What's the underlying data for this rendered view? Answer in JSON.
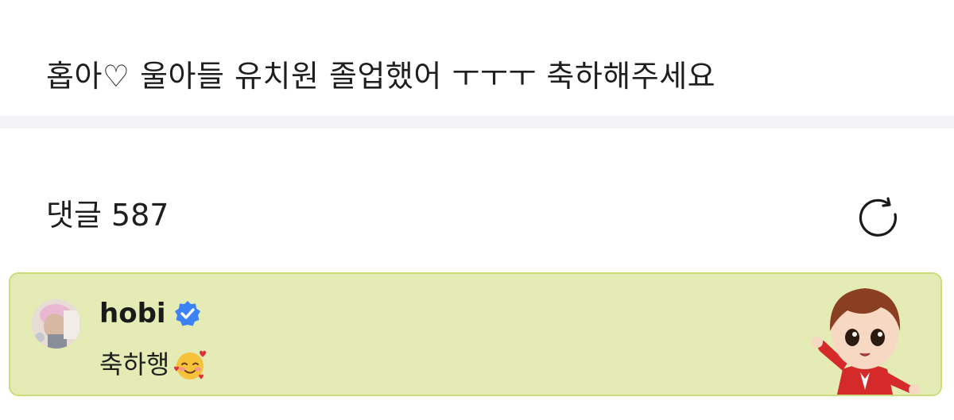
{
  "post": {
    "text": "홉아♡ 울아들 유치원 졸업했어 ㅜㅜㅜ 축하해주세요"
  },
  "comments": {
    "label": "댓글",
    "count": "587",
    "refresh_icon": "refresh-icon"
  },
  "comment": {
    "author": "hobi",
    "verified_icon": "verified-badge-icon",
    "text": "축하행",
    "emoji": "smiling-face-with-hearts",
    "sticker": "character-sticker"
  },
  "colors": {
    "highlight_bg": "#e4ebb5",
    "highlight_border": "#c9dd7a",
    "verified": "#3b82f6",
    "divider": "#f4f4f6"
  }
}
